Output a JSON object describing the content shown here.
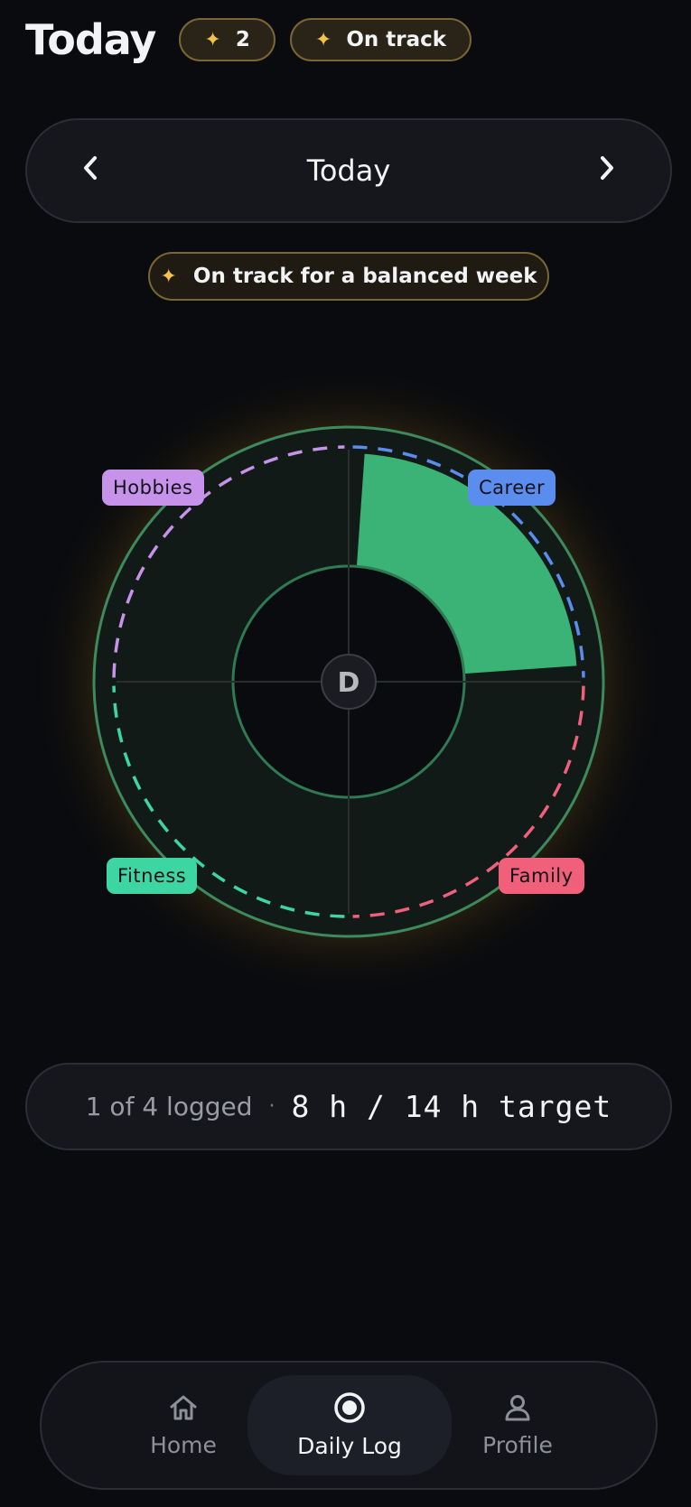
{
  "header": {
    "title": "Today",
    "streak_count": "2",
    "status_pill": "On track",
    "spark_icon": "✦"
  },
  "date_nav": {
    "label": "Today",
    "prev_icon": "‹",
    "next_icon": "›"
  },
  "banner": {
    "text": "On track for a balanced week"
  },
  "wheel": {
    "center_label": "D",
    "categories": [
      {
        "name": "Career",
        "color": "#5b8def",
        "logged_fraction": 1.0
      },
      {
        "name": "Family",
        "color": "#f0607a",
        "logged_fraction": 0
      },
      {
        "name": "Fitness",
        "color": "#3dd6a3",
        "logged_fraction": 0
      },
      {
        "name": "Hobbies",
        "color": "#c792ea",
        "logged_fraction": 0
      }
    ],
    "fill_color": "#3bb377",
    "ring_color": "#3d8a5c"
  },
  "summary": {
    "logged": "1 of 4 logged",
    "separator": "·",
    "hours": "8 h / 14 h target"
  },
  "tabs": [
    {
      "label": "Home",
      "icon": "home-icon"
    },
    {
      "label": "Daily Log",
      "icon": "record-icon"
    },
    {
      "label": "Profile",
      "icon": "person-icon"
    }
  ]
}
